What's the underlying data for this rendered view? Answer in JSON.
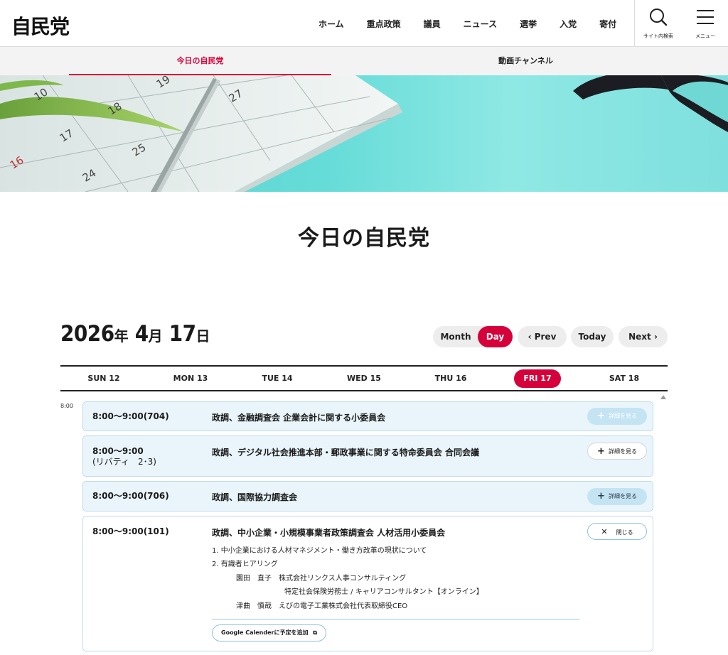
{
  "header": {
    "logo": "自民党",
    "nav": [
      "ホーム",
      "重点政策",
      "議員",
      "ニュース",
      "選挙",
      "入党",
      "寄付"
    ],
    "search_label": "サイト内検索",
    "menu_label": "メニュー"
  },
  "subnav": {
    "tabs": [
      "今日の自民党",
      "動画チャンネル"
    ],
    "active_index": 0
  },
  "hero": {
    "calendar_numbers": [
      "10",
      "19",
      "18",
      "27",
      "17",
      "16",
      "25",
      "24"
    ]
  },
  "page_title": "今日の自民党",
  "date": {
    "year": "2026",
    "year_unit": "年",
    "month": "4",
    "month_unit": "月",
    "day": "17",
    "day_unit": "日"
  },
  "controls": {
    "month": "Month",
    "day": "Day",
    "prev": "Prev",
    "today": "Today",
    "next": "Next",
    "active": "Day"
  },
  "week": [
    "SUN 12",
    "MON 13",
    "TUE 14",
    "WED 15",
    "THU 16",
    "FRI 17",
    "SAT 18"
  ],
  "week_active": "FRI 17",
  "time_label": "8:00",
  "events": [
    {
      "time": "8:00〜9:00(704)",
      "title": "政調、金融調査会 企業会計に関する小委員会",
      "button": "詳細を見る",
      "button_state": "disabled"
    },
    {
      "time": "8:00〜9:00",
      "time2": "(リバティ　2･3)",
      "title": "政調、デジタル社会推進本部・郵政事業に関する特命委員会 合同会議",
      "button": "詳細を見る",
      "button_state": "white"
    },
    {
      "time": "8:00〜9:00(706)",
      "title": "政調、国際協力調査会",
      "button": "詳細を見る",
      "button_state": "light"
    },
    {
      "time": "8:00〜9:00(101)",
      "title": "政調、中小企業・小規模事業者政策調査会 人材活用小委員会",
      "button": "閉じる",
      "button_state": "close",
      "details": [
        "1. 中小企業における人材マネジメント・働き方改革の現状について",
        "2. 有識者ヒアリング",
        "園田　直子　株式会社リンクス人事コンサルティング",
        "特定社会保険労務士 / キャリアコンサルタント【オンライン】",
        "津曲　慎哉　えびの電子工業株式会社代表取締役CEO"
      ],
      "gcal": "Google Calenderに予定を追加"
    }
  ],
  "colors": {
    "accent": "#d6003b",
    "event_bg": "#e9f5fb",
    "event_border": "#bfdbe8",
    "hero_teal": "#5fd6d3"
  }
}
